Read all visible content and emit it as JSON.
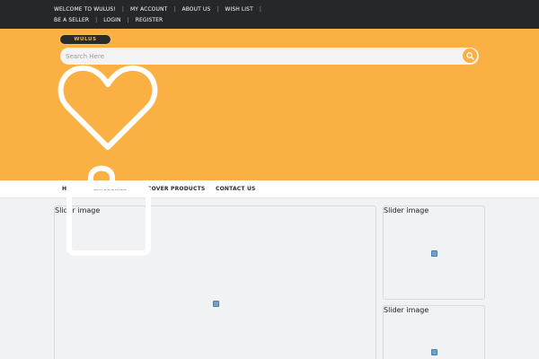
{
  "topbar": {
    "welcome": "WELCOME TO WULUS!",
    "my_account": "MY ACCOUNT",
    "about_us": "ABOUT US",
    "wish_list": "WISH LIST",
    "be_seller": "BE A SELLER",
    "login": "LOGIN",
    "register": "REGISTER",
    "separator": "|"
  },
  "logo": {
    "text": "WULUS"
  },
  "search": {
    "placeholder": "Search Here"
  },
  "nav": {
    "home": "H",
    "categories": "CATEGORIES",
    "discover": "COVER PRODUCTS",
    "contact": "CONTACT US"
  },
  "sliders": {
    "main_label": "Slider image",
    "side1_label": "Slider image",
    "side2_label": "Slider image"
  },
  "colors": {
    "brand": "#fbb043",
    "topbar": "#25272b",
    "page_bg": "#f1f2f4"
  },
  "icons": {
    "search": "search-icon",
    "heart": "heart-icon",
    "broken_image": "broken-image-icon"
  }
}
